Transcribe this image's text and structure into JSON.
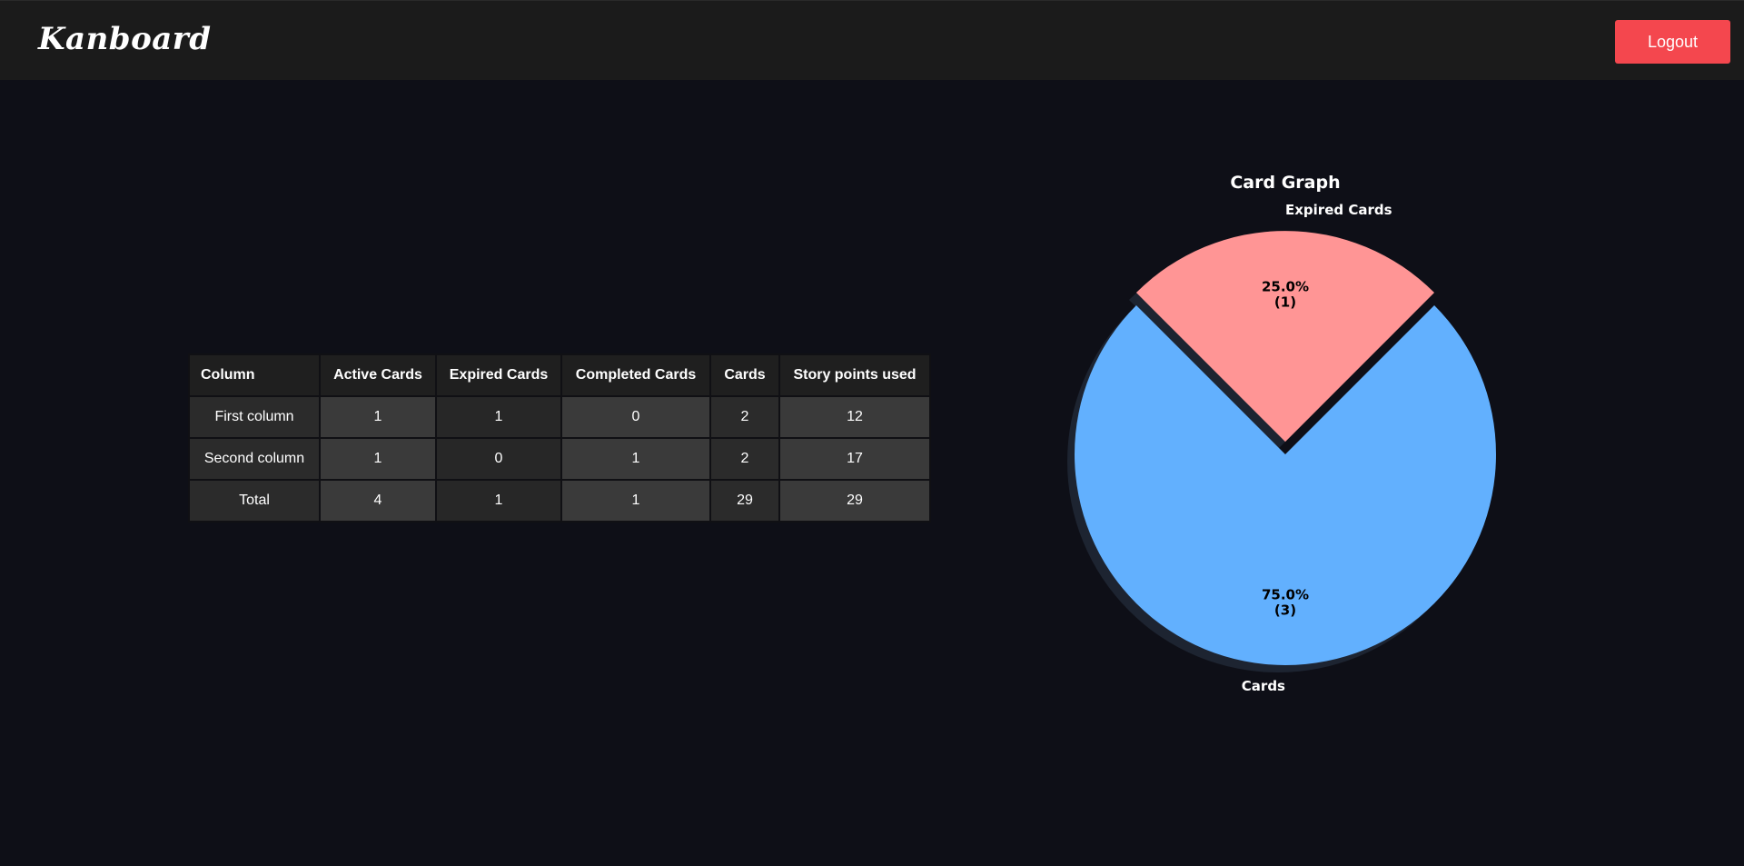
{
  "header": {
    "brand": "Kanboard",
    "logout_label": "Logout"
  },
  "table": {
    "headers": [
      "Column",
      "Active Cards",
      "Expired Cards",
      "Completed Cards",
      "Cards",
      "Story points used"
    ],
    "rows": [
      [
        "First column",
        "1",
        "1",
        "0",
        "2",
        "12"
      ],
      [
        "Second column",
        "1",
        "0",
        "1",
        "2",
        "17"
      ],
      [
        "Total",
        "4",
        "1",
        "1",
        "29",
        "29"
      ]
    ]
  },
  "chart_data": {
    "type": "pie",
    "title": "Card Graph",
    "slices": [
      {
        "label": "Expired Cards",
        "value": 1,
        "percent": "25.0%",
        "count_label": "(1)",
        "color": "#ff9595",
        "exploded": true
      },
      {
        "label": "Cards",
        "value": 3,
        "percent": "75.0%",
        "count_label": "(3)",
        "color": "#62b0fe",
        "exploded": false
      }
    ],
    "shadow": true
  },
  "colors": {
    "background": "#0e0f17",
    "topbar": "#1b1b1b",
    "logout": "#f4474e"
  }
}
